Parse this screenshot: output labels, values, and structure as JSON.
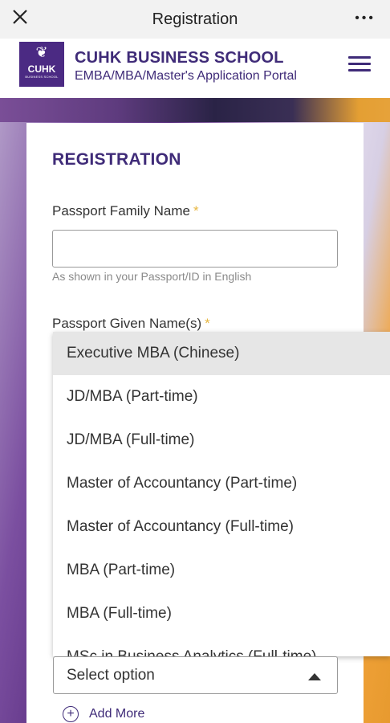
{
  "topbar": {
    "title": "Registration",
    "close_icon": "close-icon",
    "more_icon": "more-icon",
    "more_glyph": "•••"
  },
  "header": {
    "logo": {
      "mark": "❦",
      "word": "CUHK",
      "sub": "BUSINESS SCHOOL"
    },
    "school_name": "CUHK BUSINESS SCHOOL",
    "portal_name": "EMBA/MBA/Master's Application Portal",
    "menu_icon": "hamburger-icon"
  },
  "form": {
    "heading": "REGISTRATION",
    "family_name": {
      "label": "Passport Family Name",
      "required": "*",
      "value": "",
      "hint": "As shown in your Passport/ID in English"
    },
    "given_name": {
      "label": "Passport Given Name(s)",
      "required": "*"
    }
  },
  "dropdown": {
    "options": [
      "Executive MBA (Chinese)",
      "JD/MBA (Part-time)",
      "JD/MBA (Full-time)",
      "Master of Accountancy (Part-time)",
      "Master of Accountancy (Full-time)",
      "MBA (Part-time)",
      "MBA (Full-time)",
      "MSc in Business Analytics (Full-time)"
    ],
    "highlighted": "Executive MBA (Chinese)"
  },
  "select": {
    "value": "Select option"
  },
  "add_more": {
    "label": "Add More",
    "icon": "plus-circle-icon"
  },
  "colors": {
    "brand": "#3f2b78",
    "required": "#e7b742",
    "accent_orange": "#e6a23a"
  }
}
